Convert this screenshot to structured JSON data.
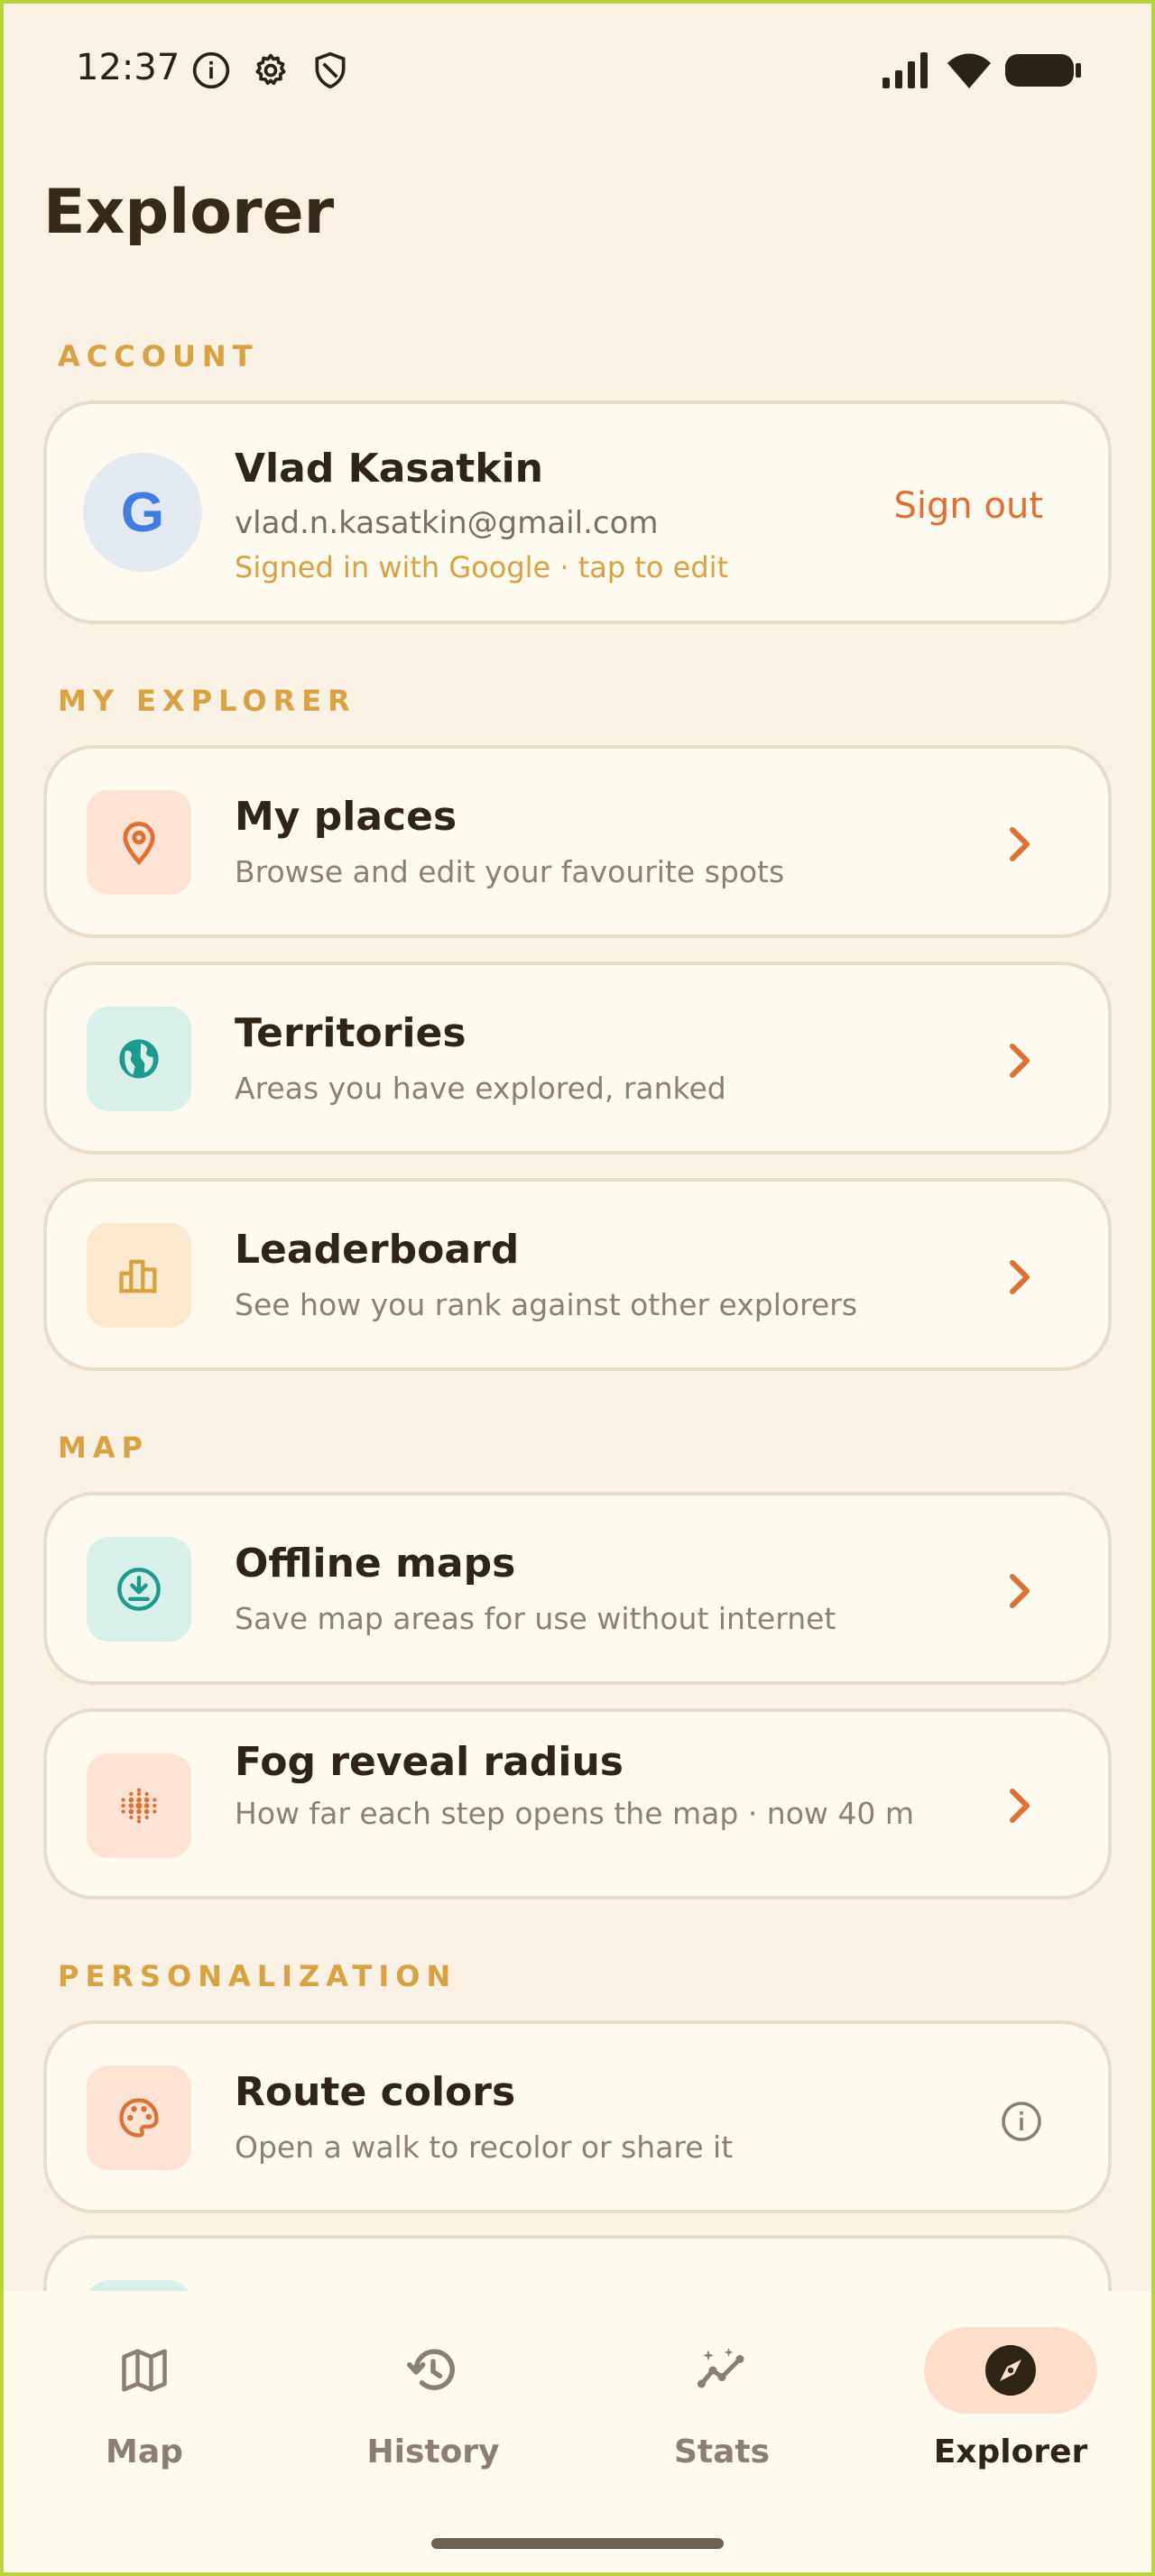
{
  "status_bar": {
    "time": "12:37"
  },
  "page": {
    "title": "Explorer"
  },
  "sections": {
    "account": "ACCOUNT",
    "my_explorer": "MY EXPLORER",
    "map": "MAP",
    "personalization": "PERSONALIZATION"
  },
  "account": {
    "avatar_letter": "G",
    "name": "Vlad Kasatkin",
    "email": "vlad.n.kasatkin@gmail.com",
    "note": "Signed in with Google · tap to edit",
    "sign_out": "Sign out"
  },
  "items": [
    {
      "title": "My places",
      "subtitle": "Browse and edit your favourite spots",
      "icon": "location-pin-icon",
      "tile_color": "#fde3d3",
      "icon_color": "#e06f30"
    },
    {
      "title": "Territories",
      "subtitle": "Areas you have explored, ranked",
      "icon": "globe-icon",
      "tile_color": "#d9efe9",
      "icon_color": "#1d9a8e"
    },
    {
      "title": "Leaderboard",
      "subtitle": "See how you rank against other explorers",
      "icon": "leaderboard-icon",
      "tile_color": "#fbe9cf",
      "icon_color": "#d9a13f"
    },
    {
      "title": "Offline maps",
      "subtitle": "Save map areas for use without internet",
      "icon": "download-icon",
      "tile_color": "#d9efe9",
      "icon_color": "#1d9a8e"
    },
    {
      "title": "Fog reveal radius",
      "subtitle": "How far each step opens the map · now 40 m",
      "icon": "dots-grid-icon",
      "tile_color": "#fde3d3",
      "icon_color": "#e06f30"
    },
    {
      "title": "Route colors",
      "subtitle": "Open a walk to recolor or share it",
      "icon": "palette-icon",
      "tile_color": "#fde3d3",
      "icon_color": "#e06f30"
    }
  ],
  "bottom_nav": [
    {
      "label": "Map",
      "icon": "map-icon"
    },
    {
      "label": "History",
      "icon": "history-icon"
    },
    {
      "label": "Stats",
      "icon": "stats-icon"
    },
    {
      "label": "Explorer",
      "icon": "compass-icon",
      "active": true
    }
  ],
  "colors": {
    "accent": "#e06f30",
    "section": "#d9a13f",
    "background": "#f9f2e4",
    "card": "#fffaef"
  }
}
